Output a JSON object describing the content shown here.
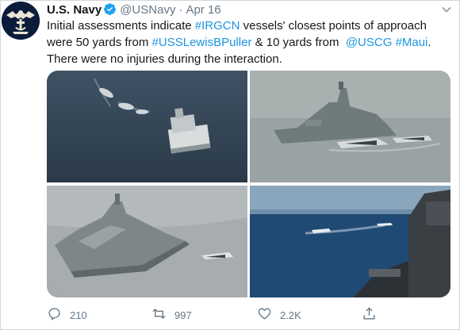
{
  "account": {
    "name": "U.S. Navy",
    "handle": "@USNavy",
    "separator": "·",
    "date": "Apr 16"
  },
  "tweet": {
    "seg1": "Initial assessments indicate ",
    "hashtag_irgcn": "#IRGCN",
    "seg2": " vessels' closest points of approach were 50 yards from ",
    "hashtag_puller": "#USSLewisBPuller",
    "seg3": " & 10 yards from  ",
    "mention_uscg": "@USCG",
    "seg4": " ",
    "hashtag_maui": "#Maui",
    "seg5": ". There were no injuries during the interaction."
  },
  "media": [
    {
      "description": "aerial-view-boats-near-ship"
    },
    {
      "description": "fast-attack-craft-near-patrol-ship"
    },
    {
      "description": "destroyer-with-small-boat"
    },
    {
      "description": "boats-alongside-ship-hull"
    }
  ],
  "actions": {
    "reply_count": "210",
    "retweet_count": "997",
    "like_count": "2.2K"
  },
  "colors": {
    "link": "#1b95e0",
    "verified": "#1da1f2",
    "muted": "#657786",
    "avatar_bg": "#0b1c3b"
  },
  "icons": {
    "reply": "reply-icon",
    "retweet": "retweet-icon",
    "like": "heart-icon",
    "share": "share-icon",
    "verified": "verified-badge-icon",
    "caret": "chevron-down-icon"
  }
}
